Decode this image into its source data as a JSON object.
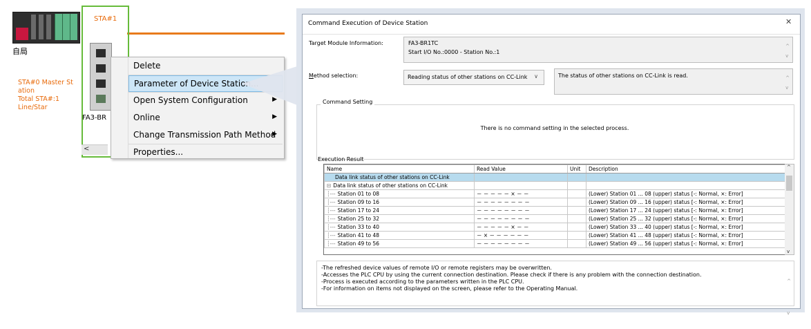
{
  "network": {
    "master_label": "自局",
    "master_info": [
      "STA#0  Master St",
      "ation",
      "Total STA#:1",
      "Line/Star"
    ],
    "station_label": "STA#1",
    "device_label": "FA3-BR",
    "accent_color": "#e86a0a",
    "selection_color": "#66bb3a"
  },
  "context_menu": {
    "items": [
      {
        "label": "Delete",
        "has_submenu": false
      },
      {
        "label": "Parameter of Device Station...",
        "has_submenu": false,
        "highlighted": true
      },
      {
        "label": "Open System Configuration",
        "has_submenu": true
      },
      {
        "label": "Online",
        "has_submenu": true
      },
      {
        "label": "Change Transmission Path Method",
        "has_submenu": true
      },
      {
        "label": "Properties...",
        "has_submenu": false
      }
    ]
  },
  "dialog": {
    "title": "Command Execution of Device Station",
    "close_glyph": "✕",
    "target_label": "Target Module Information:",
    "target_line1": "FA3-BR1TC",
    "target_line2": "Start I/O No.:0000 - Station No.:1",
    "method_label_mnemonic": "M",
    "method_label_rest": "ethod selection:",
    "method_value": "Reading status of other stations on CC-Link",
    "method_description": "The status of other stations on CC-Link is read.",
    "command_setting_label": "Command Setting",
    "command_setting_message": "There is no command setting in the selected process.",
    "execution_result_label": "Execution Result",
    "columns": [
      "Name",
      "Read Value",
      "Unit",
      "Description"
    ],
    "rows": [
      {
        "name": "Data link status of other stations on CC-Link",
        "value": "",
        "unit": "",
        "desc": "",
        "selected": true,
        "tree": ""
      },
      {
        "name": "Data link status of other stations on CC-Link",
        "value": "",
        "unit": "",
        "desc": "",
        "tree": "⊟"
      },
      {
        "name": "Station 01 to 08",
        "value": "－ － － － － × － －",
        "unit": "",
        "desc": "(Lower) Station 01 ... 08 (upper) status [-: Normal, ×: Error]",
        "tree": "┆---"
      },
      {
        "name": "Station 09 to 16",
        "value": "－ － － － － － － －",
        "unit": "",
        "desc": "(Lower) Station 09 ... 16 (upper) status [-: Normal, ×: Error]",
        "tree": "┆---"
      },
      {
        "name": "Station 17 to 24",
        "value": "－ － － － － － － －",
        "unit": "",
        "desc": "(Lower) Station 17 ... 24 (upper) status [-: Normal, ×: Error]",
        "tree": "┆---"
      },
      {
        "name": "Station 25 to 32",
        "value": "－ － － － － － － －",
        "unit": "",
        "desc": "(Lower) Station 25 ... 32 (upper) status [-: Normal, ×: Error]",
        "tree": "┆---"
      },
      {
        "name": "Station 33 to 40",
        "value": "－ － － － － × － －",
        "unit": "",
        "desc": "(Lower) Station 33 ... 40 (upper) status [-: Normal, ×: Error]",
        "tree": "┆---"
      },
      {
        "name": "Station 41 to 48",
        "value": "－ × － － － － － －",
        "unit": "",
        "desc": "(Lower) Station 41 ... 48 (upper) status [-: Normal, ×: Error]",
        "tree": "┆---"
      },
      {
        "name": "Station 49 to 56",
        "value": "－ － － － － － － －",
        "unit": "",
        "desc": "(Lower) Station 49 ... 56 (upper) status [-: Normal, ×: Error]",
        "tree": "┆---"
      }
    ],
    "notes": [
      "-The refreshed device values of remote I/O or remote registers may be overwritten.",
      "-Accesses the PLC CPU by using the current connection destination. Please check if there is any problem with the connection destination.",
      "-Process is executed according to the parameters written in the PLC CPU.",
      "-For information on items not displayed on the screen, please refer to the Operating Manual."
    ]
  }
}
